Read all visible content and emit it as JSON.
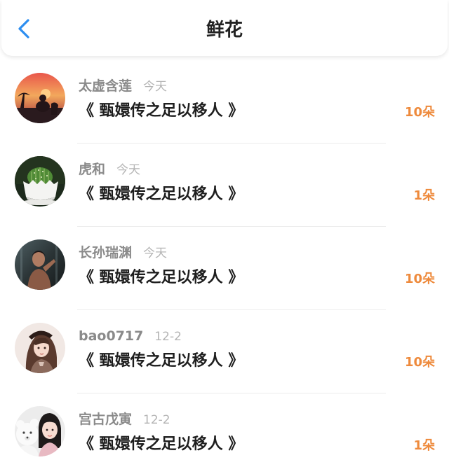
{
  "header": {
    "title": "鲜花",
    "back_icon": "chevron-left-icon",
    "accent_color": "#2d8ef0"
  },
  "records": [
    {
      "avatar": "sunset-silhouette-avatar",
      "name": "太虚含莲",
      "date": "今天",
      "book": "《 甄嬛传之足以移人 》",
      "count": "10朵"
    },
    {
      "avatar": "cactus-avatar",
      "name": "虎和",
      "date": "今天",
      "book": "《 甄嬛传之足以移人 》",
      "count": "1朵"
    },
    {
      "avatar": "dark-portrait-avatar",
      "name": "长孙瑞渊",
      "date": "今天",
      "book": "《 甄嬛传之足以移人 》",
      "count": "10朵"
    },
    {
      "avatar": "anime-girl-avatar",
      "name": "bao0717",
      "date": "12-2",
      "book": "《 甄嬛传之足以移人 》",
      "count": "10朵"
    },
    {
      "avatar": "girl-with-bear-avatar",
      "name": "宫古戊寅",
      "date": "12-2",
      "book": "《 甄嬛传之足以移人 》",
      "count": "1朵"
    }
  ],
  "colors": {
    "count": "#ee8a3c",
    "name": "#8a8a8a",
    "date": "#b4b4b4"
  }
}
